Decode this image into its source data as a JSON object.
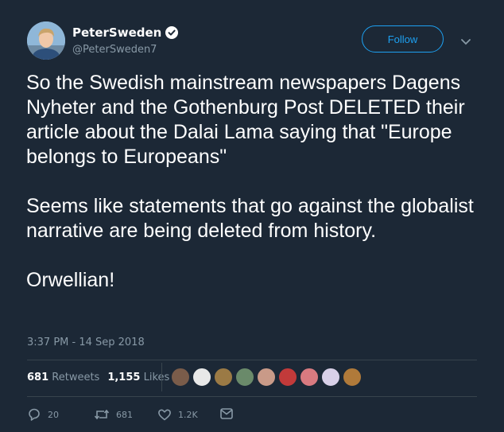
{
  "user": {
    "name": "PeterSweden",
    "handle": "@PeterSweden7"
  },
  "follow_label": "Follow",
  "tweet": {
    "paragraphs": [
      "So the Swedish mainstream newspapers Dagens Nyheter and the Gothenburg Post DELETED their article about the Dalai Lama saying that \"Europe belongs to Europeans\"",
      "Seems like statements that go against the globalist narrative are being deleted from history.",
      "Orwellian!"
    ],
    "timestamp": "3:37 PM - 14 Sep 2018"
  },
  "stats": {
    "retweets_count": "681",
    "retweets_label": "Retweets",
    "likes_count": "1,155",
    "likes_label": "Likes"
  },
  "actions": {
    "reply_count": "20",
    "retweet_count": "681",
    "like_count": "1.2K"
  },
  "colors": {
    "background": "#1c2836",
    "accent": "#1da1f2",
    "muted": "#8899a6"
  },
  "icons": [
    "verified-badge-icon",
    "chevron-down-icon",
    "reply-icon",
    "retweet-icon",
    "heart-icon",
    "message-icon"
  ]
}
